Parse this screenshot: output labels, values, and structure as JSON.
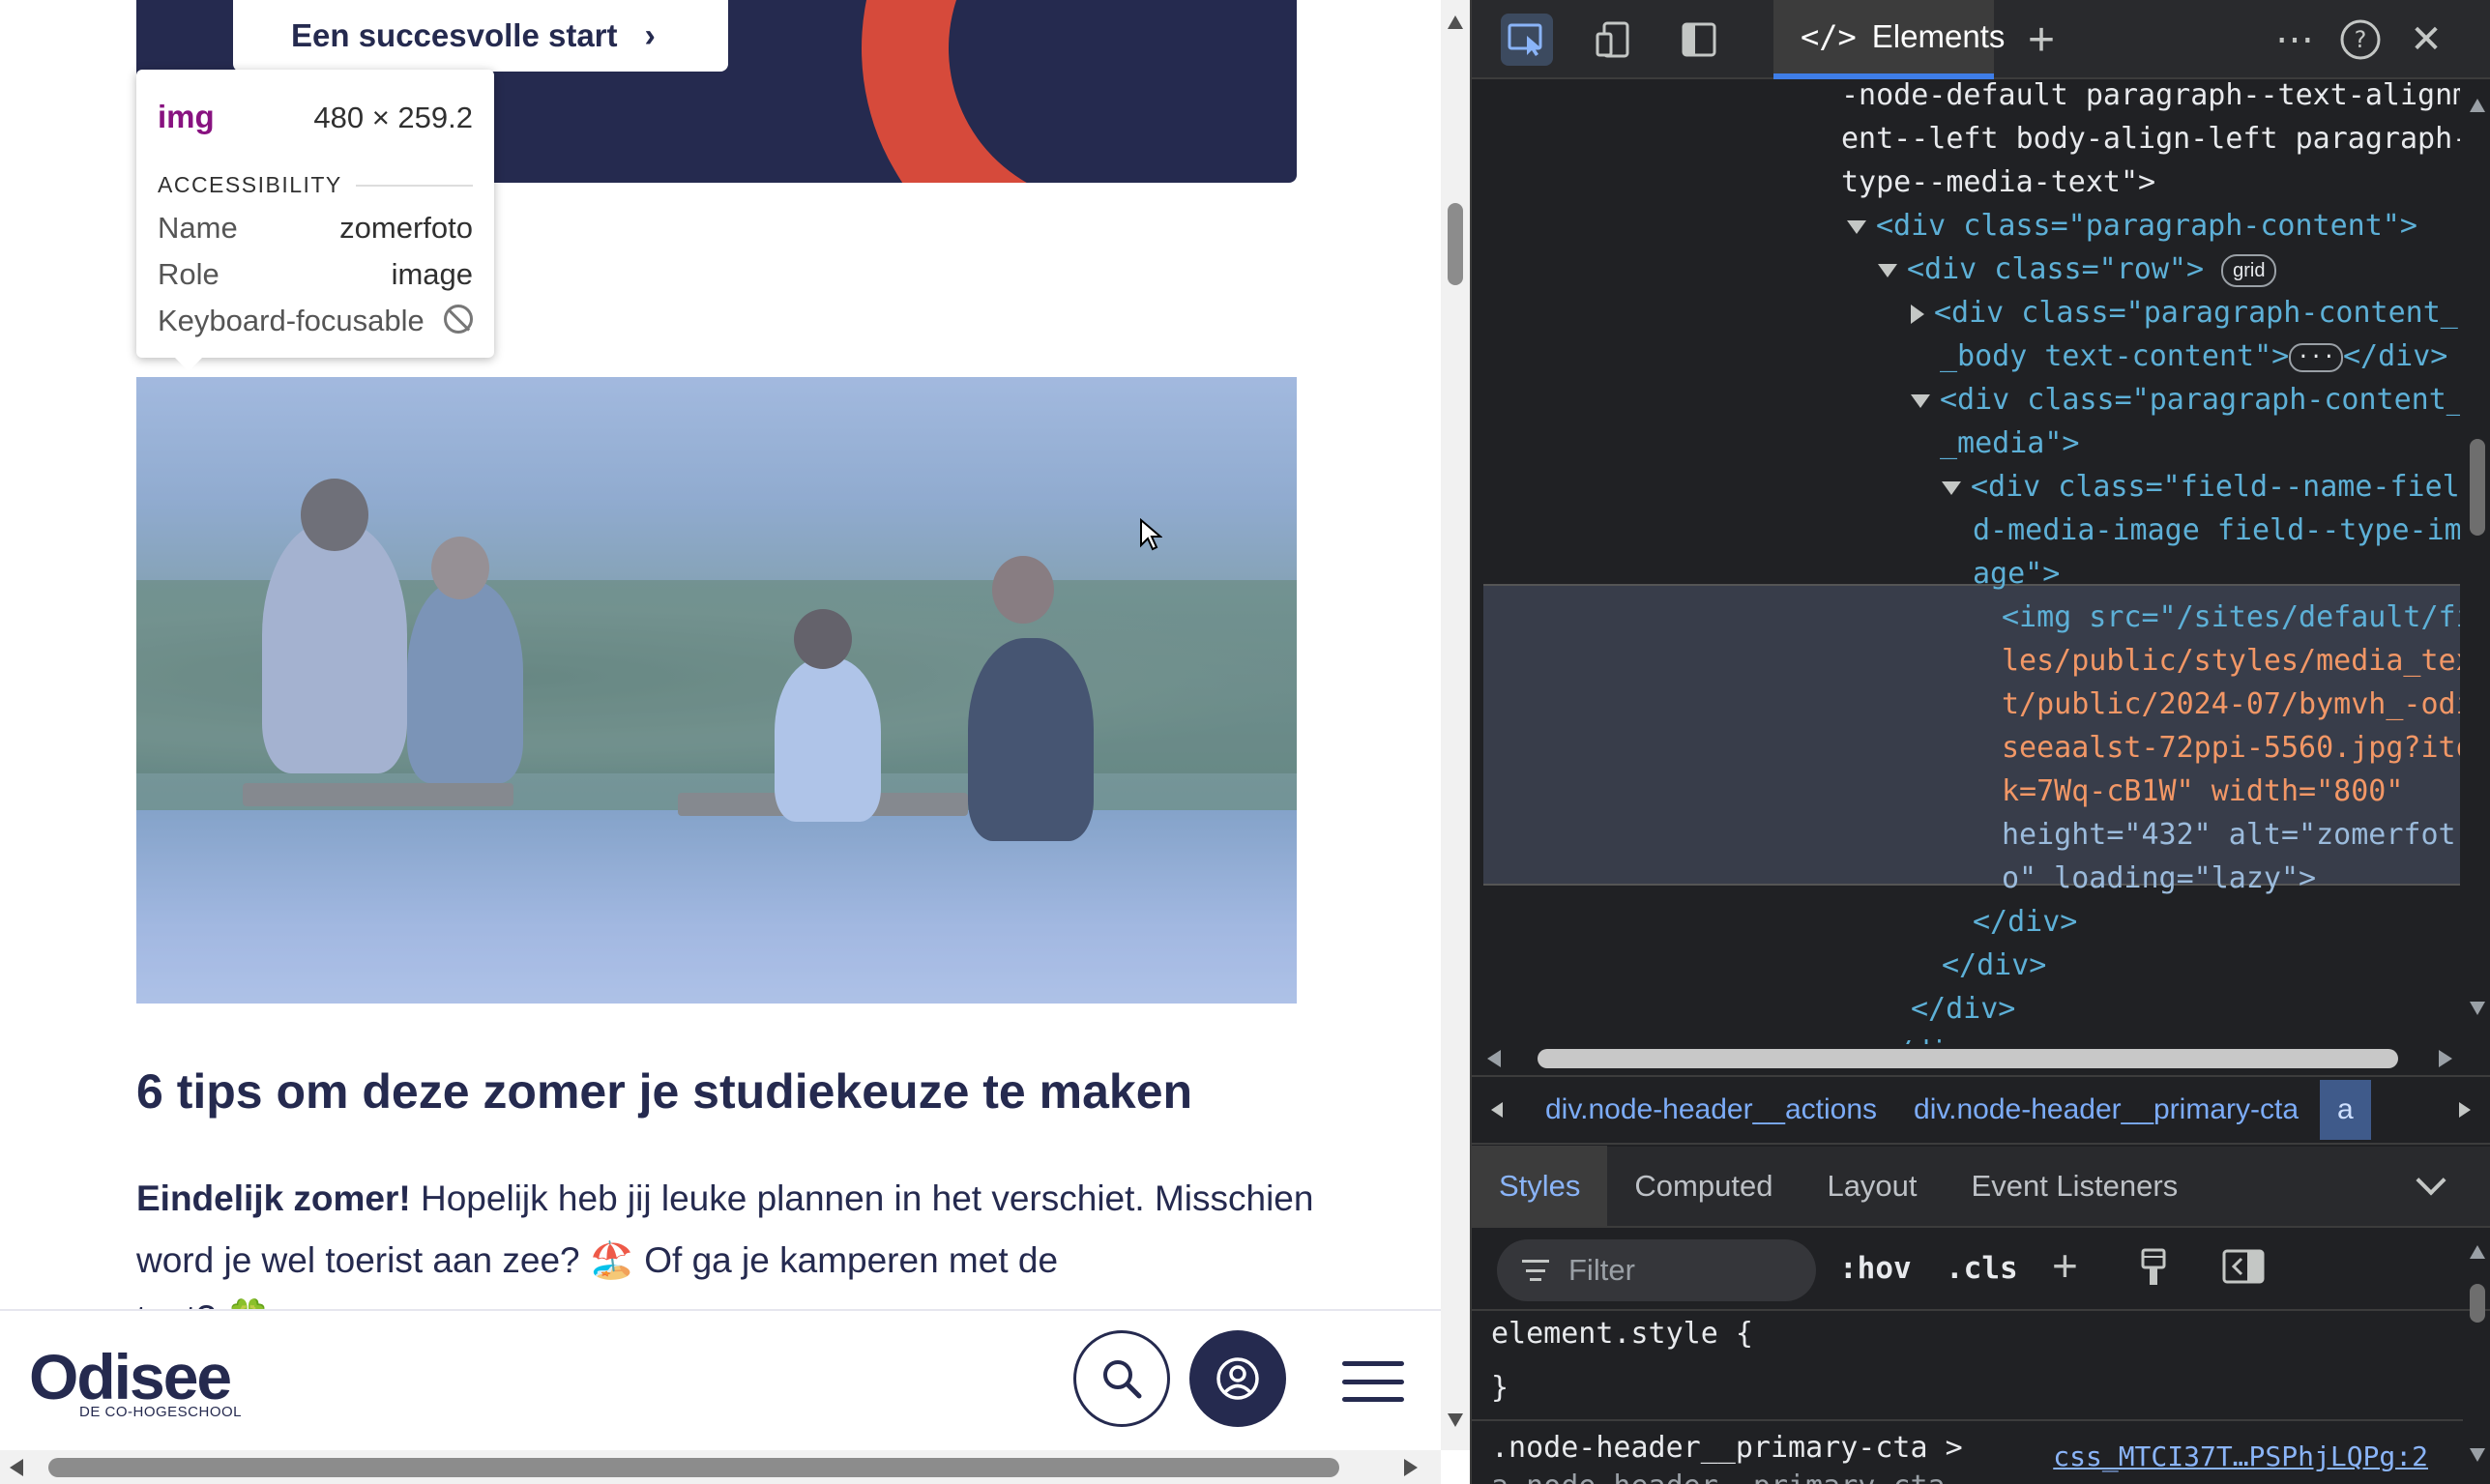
{
  "page": {
    "cta_label": "Een succesvolle start",
    "cta_chevron": "›",
    "image_alt": "zomerfoto",
    "article_title": "6 tips om deze zomer je studiekeuze te maken",
    "article_lead_bold": "Eindelijk zomer!",
    "article_lead_rest": " Hopelijk heb jij leuke plannen in het verschiet. Misschien word je wel toerist aan zee? 🏖️ Of ga je kamperen met de",
    "article_cutoff": "tent? 🍀"
  },
  "inspect_tooltip": {
    "tag": "img",
    "size": "480 × 259.2",
    "section_title": "ACCESSIBILITY",
    "rows": [
      {
        "key": "Name",
        "value": "zomerfoto"
      },
      {
        "key": "Role",
        "value": "image"
      },
      {
        "key": "Keyboard-focusable",
        "value": ""
      }
    ]
  },
  "bottom_nav": {
    "logo_word": "Odisee",
    "logo_sub": "DE CO-HOGESCHOOL",
    "search_icon": "search-icon",
    "account_icon": "user-circle-icon",
    "menu_icon": "hamburger-icon"
  },
  "devtools": {
    "toolbar": {
      "active_tab": "Elements",
      "tab_glyph": "</>",
      "icons": [
        "inspect-icon",
        "device-toolbar-icon",
        "dock-icon",
        "add-tab-icon",
        "more-icon",
        "help-icon",
        "close-icon"
      ]
    },
    "dom_lines": [
      {
        "t": "-node-default paragraph--text-alignm"
      },
      {
        "t": "ent--left body-align-left paragraph-"
      },
      {
        "t": "type--media-text\">"
      },
      {
        "t": "<div class=\"paragraph-content\">"
      },
      {
        "t": "<div class=\"row\">",
        "badge": "grid"
      },
      {
        "t": "<div class=\"paragraph-content_"
      },
      {
        "t": "_body text-content\">",
        "ellipsis": "···",
        "t2": "</div>"
      },
      {
        "t": "<div class=\"paragraph-content_"
      },
      {
        "t": "_media\">"
      },
      {
        "t": "<div class=\"field--name-fiel"
      },
      {
        "t": "d-media-image field--type-im"
      },
      {
        "t": "age\">"
      },
      {
        "t": "<img src=\"/sites/default/fi"
      },
      {
        "t": "les/public/styles/media_tex"
      },
      {
        "t": "t/public/2024-07/bymvh_-odi"
      },
      {
        "t": "seeaalst-72ppi-5560.jpg?ito"
      },
      {
        "t": "k=7Wq-cB1W\" width=\"800\""
      },
      {
        "t": "height=\"432\" alt=\"zomerfot"
      },
      {
        "t": "o\" loading=\"lazy\">"
      },
      {
        "t": "</div>"
      },
      {
        "t": "</div>"
      },
      {
        "t": "</div>"
      },
      {
        "t": "</div>"
      }
    ],
    "breadcrumbs": [
      "div.node-header__actions",
      "div.node-header__primary-cta",
      "a"
    ],
    "panel_tabs": [
      "Styles",
      "Computed",
      "Layout",
      "Event Listeners"
    ],
    "filter_placeholder": "Filter",
    "hov": ":hov",
    "cls": ".cls",
    "styles": {
      "rule1_open": "element.style {",
      "rule1_close": "}",
      "rule2_selector": ".node-header__primary-cta >",
      "rule2_selector_cont": "a.node-header__primary-cta",
      "rule2_source": "css_MTCI37T…PSPhjLQPg:2"
    }
  }
}
